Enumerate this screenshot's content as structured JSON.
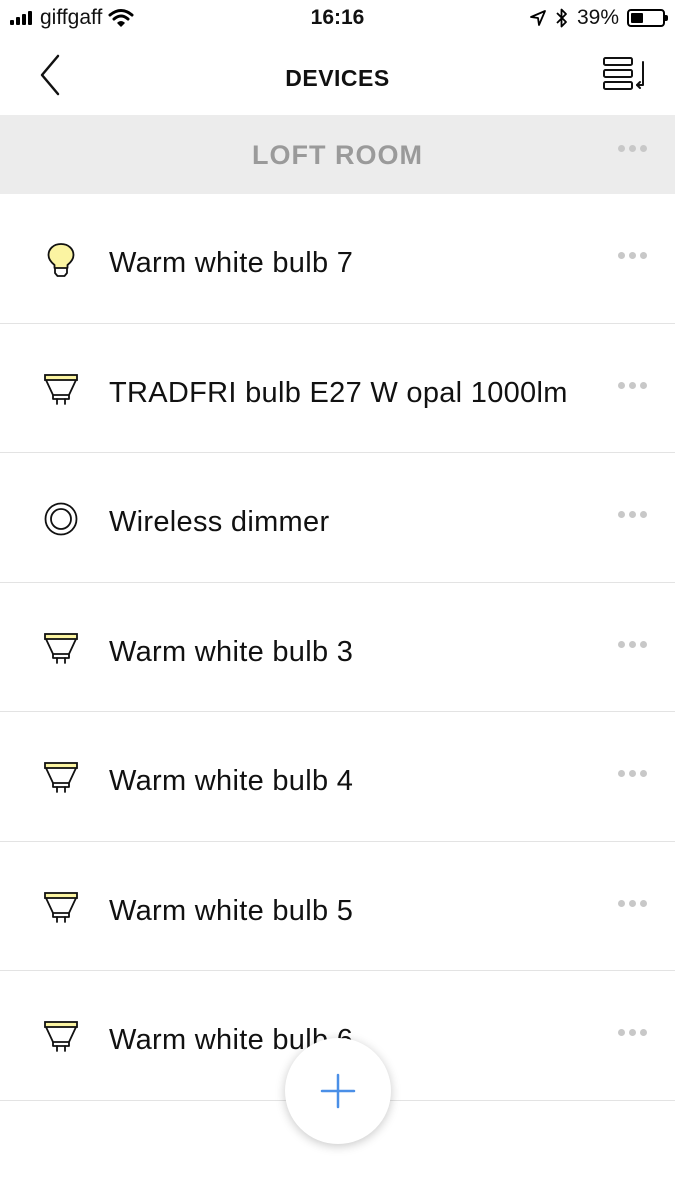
{
  "status_bar": {
    "carrier": "giffgaff",
    "time": "16:16",
    "battery": "39%",
    "battery_level": 0.39,
    "icons": [
      "signal-icon",
      "wifi-icon",
      "location-arrow-icon",
      "bluetooth-icon",
      "battery-icon"
    ]
  },
  "nav": {
    "title": "DEVICES",
    "back_icon": "chevron-left-icon",
    "right_icon": "list-sort-icon"
  },
  "section": {
    "title": "LOFT ROOM",
    "menu_icon": "more-dots-icon"
  },
  "devices": [
    {
      "label": "Warm white bulb 7",
      "icon": "a-bulb-icon"
    },
    {
      "label": "TRADFRI bulb E27 W opal 1000lm",
      "icon": "gu10-bulb-icon"
    },
    {
      "label": "Wireless dimmer",
      "icon": "dimmer-icon"
    },
    {
      "label": "Warm white bulb 3",
      "icon": "gu10-bulb-icon"
    },
    {
      "label": "Warm white bulb 4",
      "icon": "gu10-bulb-icon"
    },
    {
      "label": "Warm white bulb 5",
      "icon": "gu10-bulb-icon"
    },
    {
      "label": "Warm white bulb 6",
      "icon": "gu10-bulb-icon"
    }
  ],
  "fab": {
    "icon": "plus-icon"
  },
  "colors": {
    "bulb_fill": "#fbf4a2",
    "section_bg": "#ececec",
    "section_text": "#9a9a9a",
    "accent": "#4a8fe7"
  }
}
